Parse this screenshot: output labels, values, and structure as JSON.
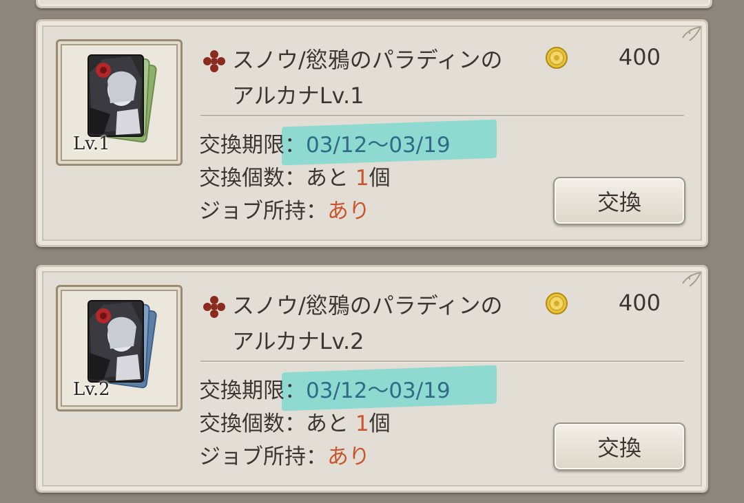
{
  "items": [
    {
      "name_line1": "スノウ/慾鴉のパラディンの",
      "name_line2": "アルカナLv.1",
      "badge": "Lv.1",
      "cost": "400",
      "period_label": "交換期限：",
      "period_value": "03/12〜03/19",
      "count_label": "交換個数：あと ",
      "count_value": "1",
      "count_unit": "個",
      "job_label": "ジョブ所持：",
      "job_value": "あり",
      "button_label": "交換"
    },
    {
      "name_line1": "スノウ/慾鴉のパラディンの",
      "name_line2": "アルカナLv.2",
      "badge": "Lv.2",
      "cost": "400",
      "period_label": "交換期限：",
      "period_value": "03/12〜03/19",
      "count_label": "交換個数：あと ",
      "count_value": "1",
      "count_unit": "個",
      "job_label": "ジョブ所持：",
      "job_value": "あり",
      "button_label": "交換"
    }
  ],
  "colors": {
    "panel": "#e3ded5",
    "text": "#3b3631",
    "accent_orange": "#c8552b",
    "highlight": "#80d9cf",
    "cross_icon": "#8b2a1f"
  },
  "icons": {
    "item_marker": "cross-icon",
    "currency": "coin-icon"
  }
}
